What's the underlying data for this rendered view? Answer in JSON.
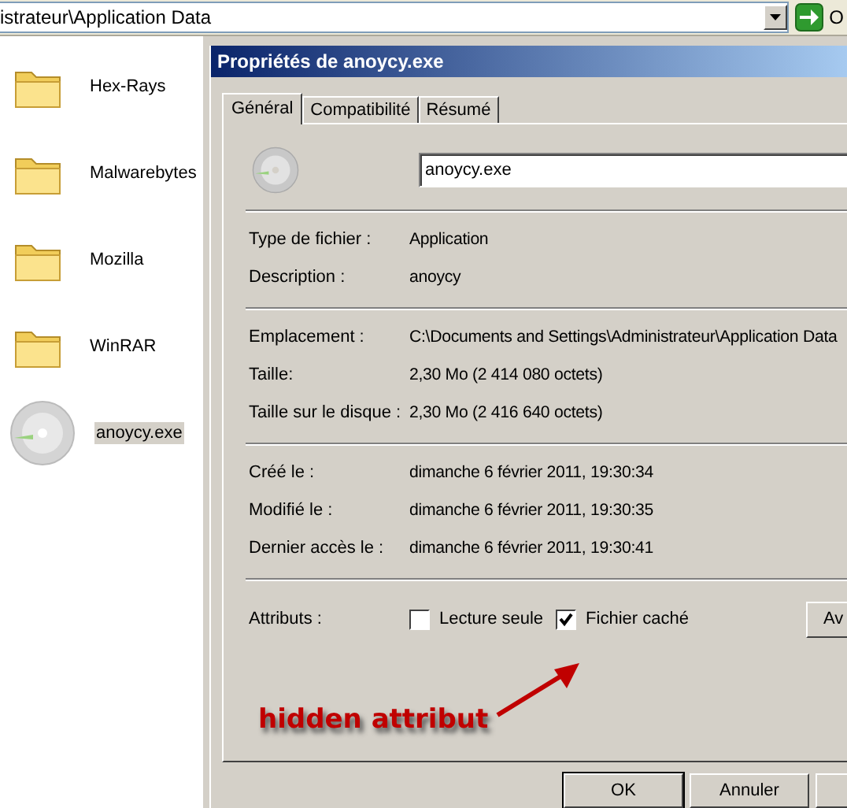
{
  "address_bar": {
    "path": "istrateur\\Application Data",
    "go_label": "O"
  },
  "explorer": {
    "items": [
      {
        "name": "Hex-Rays",
        "kind": "folder",
        "selected": false
      },
      {
        "name": "Malwarebytes",
        "kind": "folder",
        "selected": false
      },
      {
        "name": "Mozilla",
        "kind": "folder",
        "selected": false
      },
      {
        "name": "WinRAR",
        "kind": "folder",
        "selected": false
      },
      {
        "name": "anoycy.exe",
        "kind": "disc",
        "selected": true
      }
    ]
  },
  "dialog": {
    "title": "Propriétés de anoycy.exe",
    "tabs": [
      {
        "label": "Général",
        "selected": true
      },
      {
        "label": "Compatibilité",
        "selected": false
      },
      {
        "label": "Résumé",
        "selected": false
      }
    ],
    "file_name": "anoycy.exe",
    "groups": [
      [
        {
          "label": "Type de fichier :",
          "value": "Application"
        },
        {
          "label": "Description :",
          "value": "anoycy"
        }
      ],
      [
        {
          "label": "Emplacement :",
          "value": "C:\\Documents and Settings\\Administrateur\\Application Data"
        },
        {
          "label": "Taille:",
          "value": "2,30 Mo (2 414 080 octets)"
        },
        {
          "label": "Taille sur le disque :",
          "value": "2,30 Mo (2 416 640 octets)"
        }
      ],
      [
        {
          "label": "Créé le :",
          "value": "dimanche 6 février 2011, 19:30:34"
        },
        {
          "label": "Modifié le :",
          "value": "dimanche 6 février 2011, 19:30:35"
        },
        {
          "label": "Dernier accès le :",
          "value": "dimanche 6 février 2011, 19:30:41"
        }
      ]
    ],
    "attributes": {
      "label": "Attributs :",
      "options": [
        {
          "label": "Lecture seule",
          "checked": false
        },
        {
          "label": "Fichier caché",
          "checked": true
        }
      ],
      "advanced_button": "Av"
    },
    "buttons": [
      "OK",
      "Annuler"
    ]
  },
  "annotation": {
    "text": "hidden attribut"
  }
}
